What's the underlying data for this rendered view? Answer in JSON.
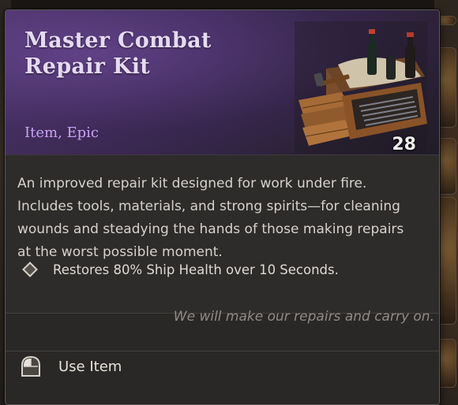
{
  "item": {
    "title": "Master Combat Repair Kit",
    "type": "Item, Epic",
    "count": "28",
    "rarity_color": "#c9a2f2",
    "icon": "repair-kit-crate-icon"
  },
  "description": "An improved repair kit designed for work under fire. Includes tools, materials, and strong spirits—for cleaning wounds and steadying the hands of those making repairs at the worst possible moment.",
  "effects": [
    {
      "icon": "diamond-bullet-icon",
      "text": "Restores 80% Ship Health over 10 Seconds."
    }
  ],
  "flavor_text": "We will make our repairs and carry on.",
  "actions": [
    {
      "icon": "mouse-button-icon",
      "label": "Use Item"
    }
  ]
}
